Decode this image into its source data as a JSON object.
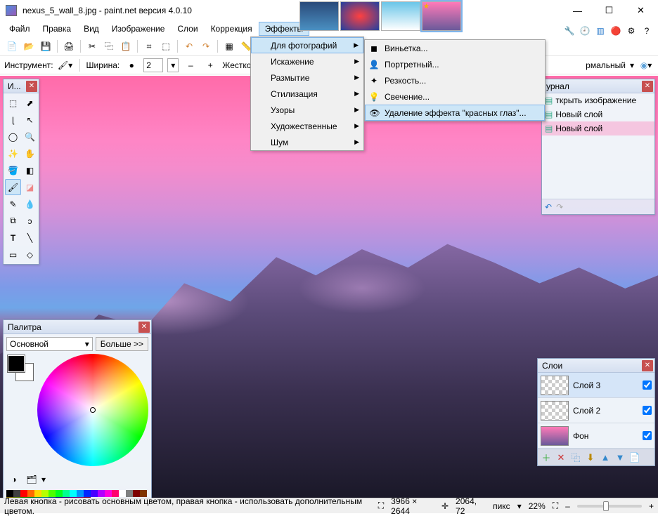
{
  "title": "nexus_5_wall_8.jpg - paint.net версия 4.0.10",
  "menu": [
    "Файл",
    "Правка",
    "Вид",
    "Изображение",
    "Слои",
    "Коррекция",
    "Эффекты"
  ],
  "effects_menu": [
    {
      "label": "Для фотографий",
      "sub": true,
      "hover": true
    },
    {
      "label": "Искажение",
      "sub": true
    },
    {
      "label": "Размытие",
      "sub": true
    },
    {
      "label": "Стилизация",
      "sub": true
    },
    {
      "label": "Узоры",
      "sub": true
    },
    {
      "label": "Художественные",
      "sub": true
    },
    {
      "label": "Шум",
      "sub": true
    }
  ],
  "photo_submenu": [
    {
      "label": "Виньетка...",
      "icon": "◼"
    },
    {
      "label": "Портретный...",
      "icon": "👤"
    },
    {
      "label": "Резкость...",
      "icon": "✦"
    },
    {
      "label": "Свечение...",
      "icon": "💡"
    },
    {
      "label": "Удаление эффекта \"красных глаз\"...",
      "icon": "👁",
      "hover": true
    }
  ],
  "optbar": {
    "tool_label": "Инструмент:",
    "width_label": "Ширина:",
    "width_value": "2",
    "hardness_label": "Жесткость:",
    "mode_label": "рмальный"
  },
  "panels": {
    "tools_title": "И...",
    "palette_title": "Палитра",
    "palette_mode": "Основной",
    "palette_more": "Больше >>",
    "history_title": "урнал",
    "history_items": [
      "ткрыть изображение",
      "Новый слой",
      "Новый слой"
    ],
    "layers_title": "Слои",
    "layers": [
      {
        "name": "Слой 3",
        "checked": true
      },
      {
        "name": "Слой 2",
        "checked": true
      },
      {
        "name": "Фон",
        "checked": true
      }
    ]
  },
  "status": {
    "hint": "Левая кнопка - рисовать основным цветом, правая кнопка - использовать дополнительным цветом.",
    "dims": "3966 × 2644",
    "pos": "2064, 72",
    "unit": "пикс",
    "zoom": "22%"
  },
  "palette_colors": [
    "#000",
    "#404040",
    "#ff0000",
    "#ff6a00",
    "#ffd800",
    "#b6ff00",
    "#4cff00",
    "#00ff21",
    "#00ff90",
    "#00ffff",
    "#0094ff",
    "#0026ff",
    "#4800ff",
    "#b200ff",
    "#ff00dc",
    "#ff006e",
    "#fff",
    "#808080",
    "#7f0000",
    "#7f3300",
    "#7f6a00",
    "#5b7f00",
    "#267f00",
    "#007f0e",
    "#007f46",
    "#007f7f",
    "#004a7f",
    "#00137f",
    "#24007f",
    "#57007f",
    "#7f006e",
    "#7f0037"
  ]
}
